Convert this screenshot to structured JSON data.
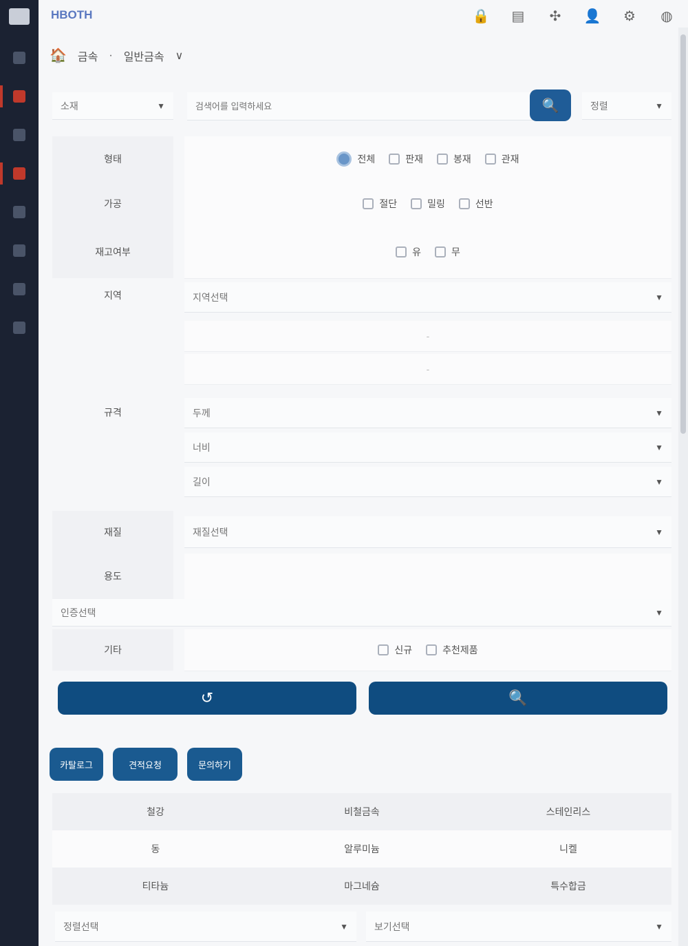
{
  "brand": "HBOTH",
  "topbar": {
    "icons": [
      "lock-icon",
      "document-icon",
      "grid-icon",
      "user-icon",
      "settings-icon",
      "globe-icon"
    ]
  },
  "breadcrumb": {
    "item1": "금속",
    "item2": "일반금속",
    "chevron": "∨"
  },
  "search": {
    "category": "소재",
    "placeholder": "검색어를 입력하세요",
    "sort": "정렬",
    "search_icon": "🔍",
    "dropdown_arrow": "▼"
  },
  "filters": {
    "row1": {
      "label": "형태",
      "options": [
        "전체",
        "판재",
        "봉재",
        "관재"
      ]
    },
    "row2": {
      "label": "가공",
      "options": [
        "절단",
        "밀링",
        "선반"
      ]
    },
    "row3": {
      "label": "재고여부",
      "options": [
        "유",
        "무"
      ]
    },
    "row4": {
      "label": "지역",
      "select": "지역선택",
      "sub1": "-",
      "sub2": "-"
    },
    "row5": {
      "label": "규격",
      "select1": "두께",
      "select2": "너비",
      "select3": "길이"
    },
    "row6": {
      "label": "재질",
      "select": "재질선택"
    },
    "row7": {
      "label": "용도"
    },
    "row8": {
      "select": "인증선택"
    },
    "row9": {
      "label": "기타",
      "options": [
        "신규",
        "추천제품"
      ]
    }
  },
  "actions": {
    "reset_icon": "↺",
    "search_icon": "🔍"
  },
  "buttons": {
    "btn1": "카탈로그",
    "btn2": "견적요청",
    "btn3": "문의하기"
  },
  "table": {
    "rows": [
      [
        "철강",
        "비철금속",
        "스테인리스"
      ],
      [
        "동",
        "알루미늄",
        "니켈"
      ],
      [
        "티타늄",
        "마그네슘",
        "특수합금"
      ]
    ]
  },
  "bottom": {
    "select1": "정렬선택",
    "select2": "보기선택"
  }
}
